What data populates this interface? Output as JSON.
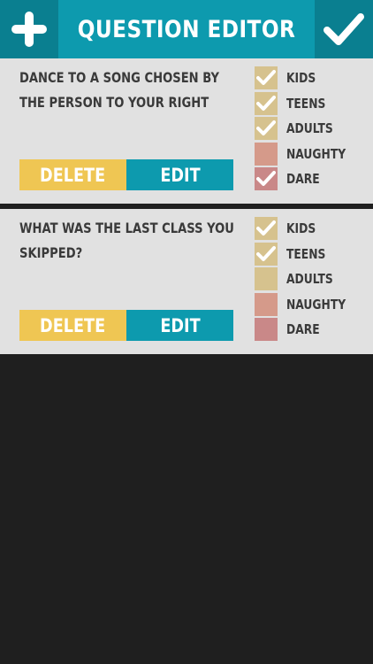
{
  "header": {
    "title": "QUESTION EDITOR",
    "add_icon": "plus-icon",
    "confirm_icon": "checkmark-icon"
  },
  "colors": {
    "teal": "#0d9aae",
    "teal_dark": "#0a7f90",
    "yellow": "#efc653",
    "card_bg": "#e1e1e1",
    "page_bg": "#1f1f1f",
    "tan": "#d6c28e",
    "salmon": "#d59a8a",
    "rose": "#c98888"
  },
  "questions": [
    {
      "text": "DANCE TO A SONG CHOSEN BY THE PERSON TO YOUR RIGHT",
      "delete_label": "DELETE",
      "edit_label": "EDIT",
      "categories": [
        {
          "label": "KIDS",
          "checked": true
        },
        {
          "label": "TEENS",
          "checked": true
        },
        {
          "label": "ADULTS",
          "checked": true
        },
        {
          "label": "NAUGHTY",
          "checked": false
        },
        {
          "label": "DARE",
          "checked": true
        }
      ]
    },
    {
      "text": "WHAT WAS THE LAST CLASS YOU SKIPPED?",
      "delete_label": "DELETE",
      "edit_label": "EDIT",
      "categories": [
        {
          "label": "KIDS",
          "checked": true
        },
        {
          "label": "TEENS",
          "checked": true
        },
        {
          "label": "ADULTS",
          "checked": false
        },
        {
          "label": "NAUGHTY",
          "checked": false
        },
        {
          "label": "DARE",
          "checked": false
        }
      ]
    }
  ]
}
